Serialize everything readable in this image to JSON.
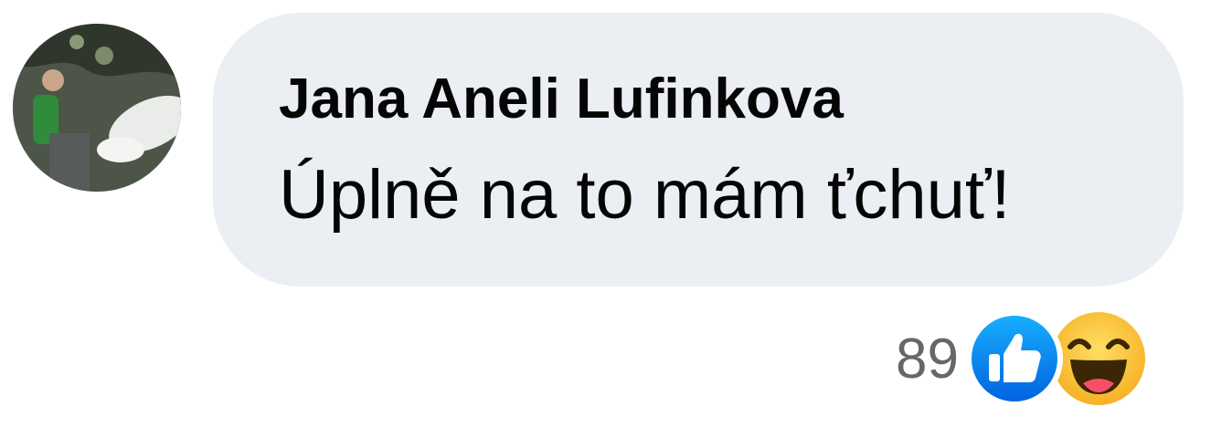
{
  "comment": {
    "author": "Jana Aneli Lufinkova",
    "text": "Úplně na to mám ťchuť!",
    "avatar_icon": "user-avatar-photo"
  },
  "reactions": {
    "count": "89",
    "icons": [
      "like-icon",
      "haha-icon"
    ],
    "colors": {
      "like": "#1877f2",
      "haha": "#f7b125"
    }
  },
  "colors": {
    "bubble_background": "#ebeef3",
    "text": "#050505",
    "secondary_text": "#65676b"
  }
}
